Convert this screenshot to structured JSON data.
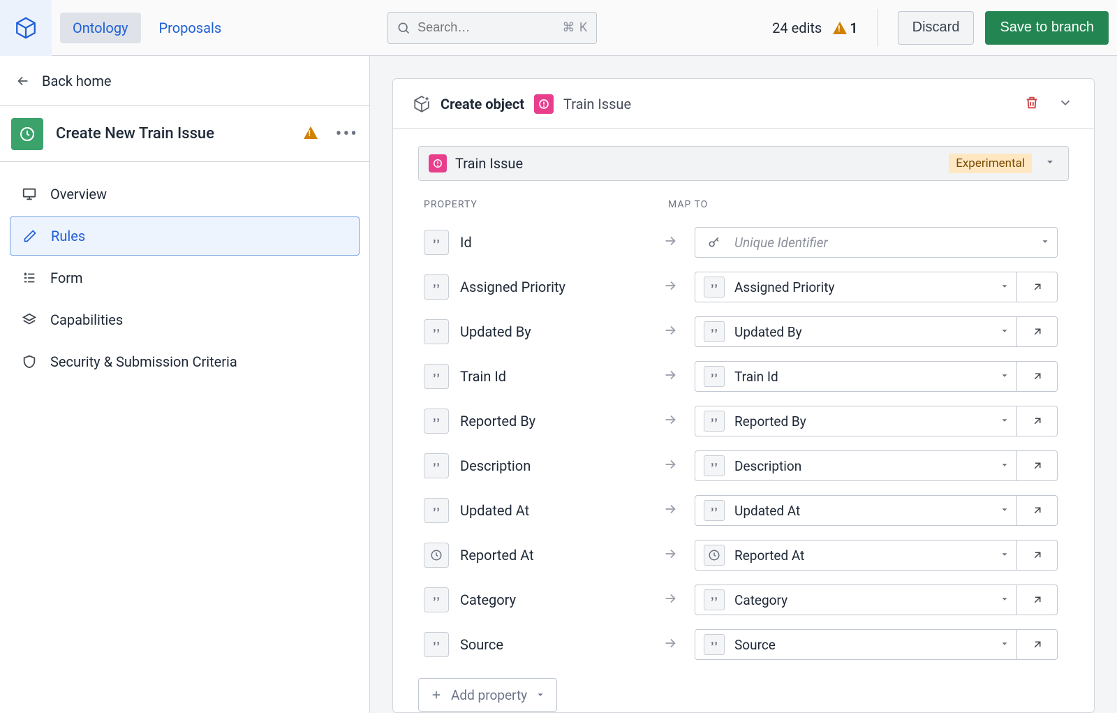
{
  "header": {
    "tabs": {
      "ontology": "Ontology",
      "proposals": "Proposals"
    },
    "search_placeholder": "Search…",
    "search_shortcut": "⌘ K",
    "edits_text": "24 edits",
    "warning_count": "1",
    "discard_label": "Discard",
    "save_label": "Save to branch"
  },
  "sidebar": {
    "back_label": "Back home",
    "title": "Create New Train Issue",
    "items": {
      "overview": "Overview",
      "rules": "Rules",
      "form": "Form",
      "capabilities": "Capabilities",
      "security": "Security & Submission Criteria"
    }
  },
  "panel": {
    "header_action": "Create object",
    "header_object": "Train Issue",
    "object_bar_name": "Train Issue",
    "experimental_label": "Experimental",
    "col_property": "PROPERTY",
    "col_mapto": "MAP TO"
  },
  "properties": [
    {
      "name": "Id",
      "type": "string",
      "map": "Unique Identifier",
      "placeholder": true
    },
    {
      "name": "Assigned Priority",
      "type": "string",
      "map": "Assigned Priority",
      "placeholder": false
    },
    {
      "name": "Updated By",
      "type": "string",
      "map": "Updated By",
      "placeholder": false
    },
    {
      "name": "Train Id",
      "type": "string",
      "map": "Train Id",
      "placeholder": false
    },
    {
      "name": "Reported By",
      "type": "string",
      "map": "Reported By",
      "placeholder": false
    },
    {
      "name": "Description",
      "type": "string",
      "map": "Description",
      "placeholder": false
    },
    {
      "name": "Updated At",
      "type": "string",
      "map": "Updated At",
      "placeholder": false
    },
    {
      "name": "Reported At",
      "type": "datetime",
      "map": "Reported At",
      "placeholder": false
    },
    {
      "name": "Category",
      "type": "string",
      "map": "Category",
      "placeholder": false
    },
    {
      "name": "Source",
      "type": "string",
      "map": "Source",
      "placeholder": false
    }
  ],
  "add_property_label": "Add property"
}
